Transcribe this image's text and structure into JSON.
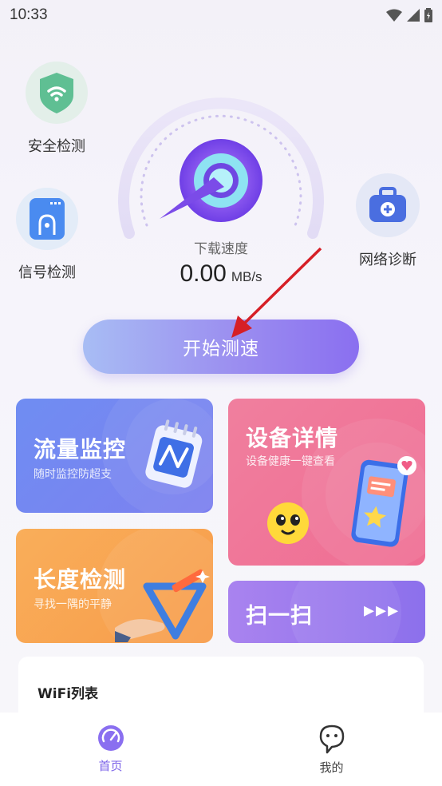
{
  "status_bar": {
    "time": "10:33"
  },
  "side_buttons": {
    "security": {
      "label": "安全检测",
      "icon": "shield-wifi-icon",
      "color": "#5fbf93"
    },
    "signal": {
      "label": "信号检测",
      "icon": "signal-card-icon",
      "color": "#4a8bf0"
    },
    "diagnose": {
      "label": "网络诊断",
      "icon": "toolbox-icon",
      "color": "#4a6ee0"
    }
  },
  "speed": {
    "label": "下载速度",
    "value": "0.00",
    "unit": "MB/s"
  },
  "start_button": {
    "label": "开始测速"
  },
  "cards": {
    "traffic": {
      "title": "流量监控",
      "subtitle": "随时监控防超支"
    },
    "device": {
      "title": "设备详情",
      "subtitle": "设备健康一键查看"
    },
    "length": {
      "title": "长度检测",
      "subtitle": "寻找一隅的平静"
    },
    "scan": {
      "title": "扫一扫",
      "arrows": "▸▸▸"
    }
  },
  "wifi_list": {
    "title": "WiFi列表"
  },
  "tabbar": {
    "home": {
      "label": "首页",
      "icon": "gauge-icon"
    },
    "mine": {
      "label": "我的",
      "icon": "profile-face-icon"
    }
  },
  "colors": {
    "accent": "#7b62e8",
    "gauge_ring": "#e4def5",
    "traffic_card": "#7488f1",
    "device_card": "#ef7599",
    "length_card": "#f8a552",
    "scan_card": "#9a79ed"
  }
}
